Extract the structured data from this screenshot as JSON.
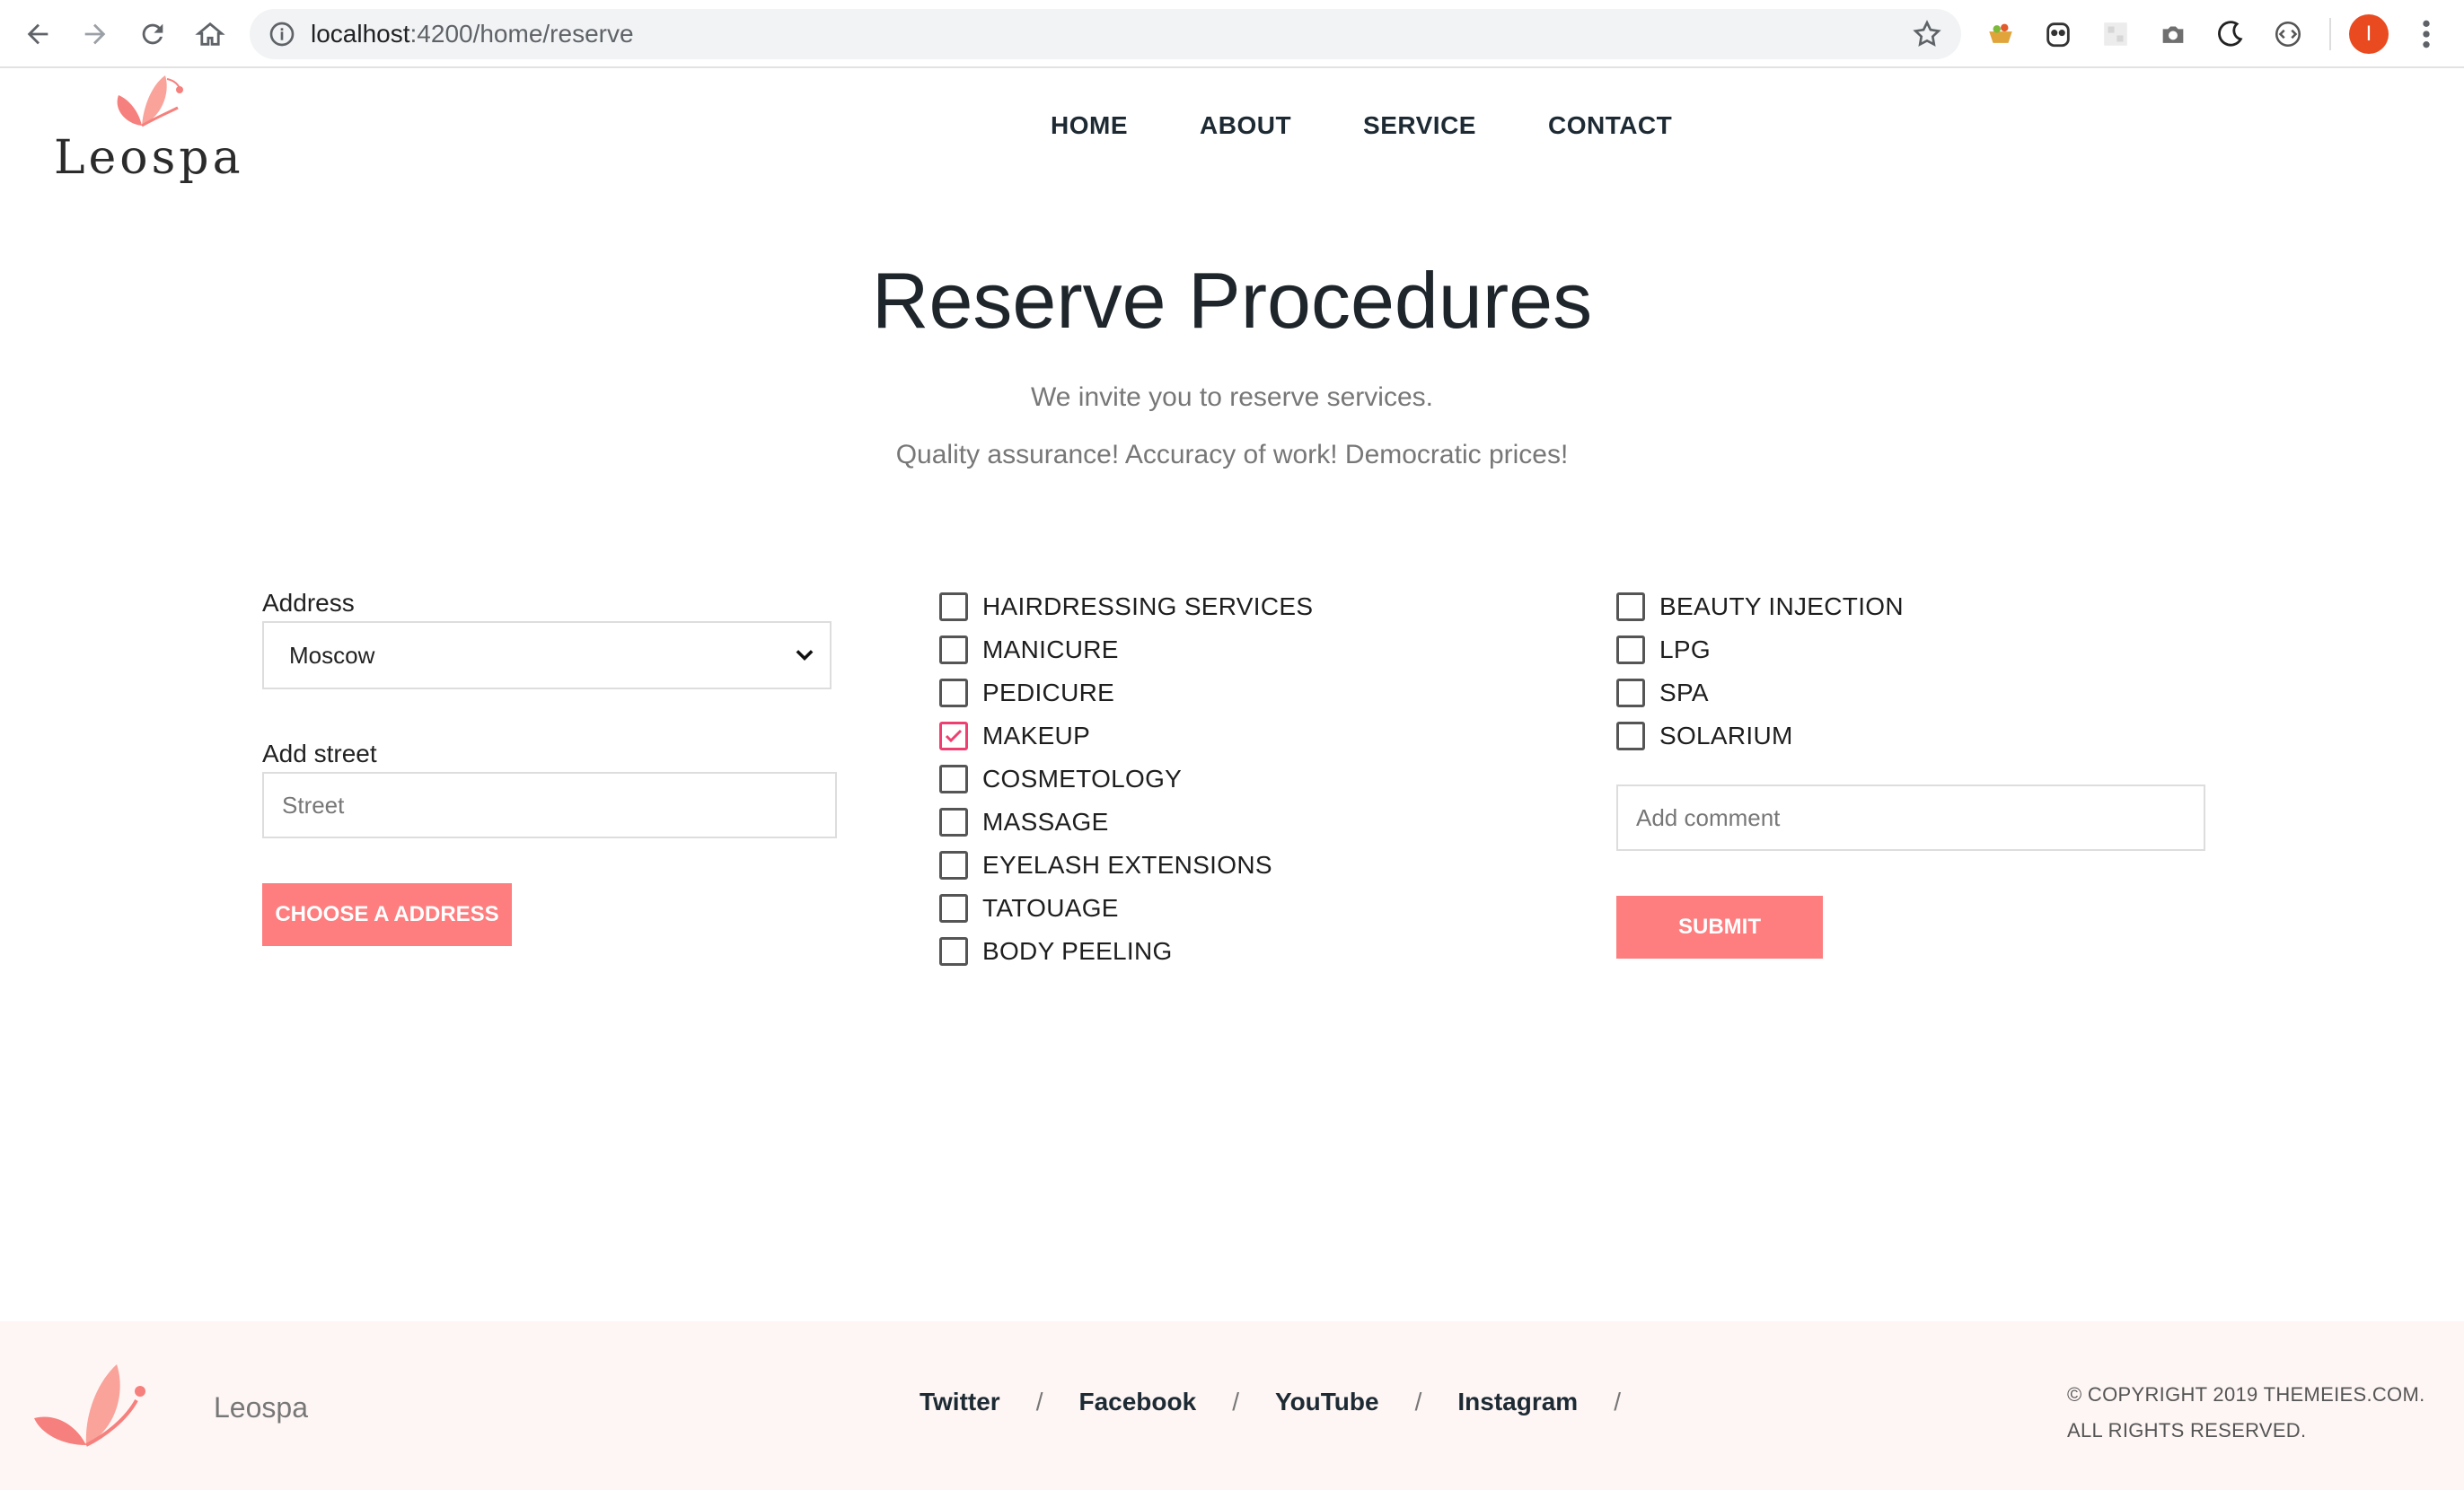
{
  "browser": {
    "url_host": "localhost",
    "url_path": ":4200/home/reserve",
    "profile_initial": "I"
  },
  "site": {
    "logo_text": "Leospa",
    "nav": [
      "HOME",
      "ABOUT",
      "SERVICE",
      "CONTACT"
    ]
  },
  "hero": {
    "title": "Reserve Procedures",
    "line1": "We invite you to reserve services.",
    "line2": "Quality assurance! Accuracy of work! Democratic prices!"
  },
  "form": {
    "address_label": "Address",
    "address_value": "Moscow",
    "street_label": "Add street",
    "street_placeholder": "Street",
    "choose_button": "CHOOSE A ADDRESS",
    "comment_placeholder": "Add comment",
    "submit_button": "SUBMIT"
  },
  "services_left": [
    {
      "label": "HAIRDRESSING SERVICES",
      "checked": false
    },
    {
      "label": "MANICURE",
      "checked": false
    },
    {
      "label": "PEDICURE",
      "checked": false
    },
    {
      "label": "MAKEUP",
      "checked": true
    },
    {
      "label": "COSMETOLOGY",
      "checked": false
    },
    {
      "label": "MASSAGE",
      "checked": false
    },
    {
      "label": "EYELASH EXTENSIONS",
      "checked": false
    },
    {
      "label": "TATOUAGE",
      "checked": false
    },
    {
      "label": "BODY PEELING",
      "checked": false
    }
  ],
  "services_right": [
    {
      "label": "BEAUTY INJECTION",
      "checked": false
    },
    {
      "label": "LPG",
      "checked": false
    },
    {
      "label": "SPA",
      "checked": false
    },
    {
      "label": "SOLARIUM",
      "checked": false
    }
  ],
  "footer": {
    "brand": "Leospa",
    "links": [
      "Twitter",
      "Facebook",
      "YouTube",
      "Instagram"
    ],
    "copyright_line1": "© COPYRIGHT 2019 THEMEIES.COM.",
    "copyright_line2": "ALL RIGHTS RESERVED."
  },
  "colors": {
    "accent": "#fe7d7f",
    "check_accent": "#ee3f70",
    "footer_bg": "#fef6f5"
  }
}
